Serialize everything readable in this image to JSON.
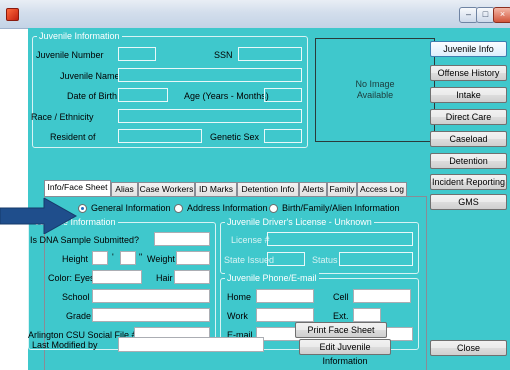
{
  "window": {
    "title": ""
  },
  "juvenile_info": {
    "legend": "Juvenile Information",
    "juvenile_number_label": "Juvenile Number",
    "ssn_label": "SSN",
    "juvenile_name_label": "Juvenile Name",
    "dob_label": "Date of Birth",
    "age_label": "Age (Years - Months)",
    "race_label": "Race / Ethnicity",
    "resident_label": "Resident of",
    "genetic_sex_label": "Genetic Sex"
  },
  "photo": {
    "text": "No Image Available"
  },
  "right_nav": [
    "Juvenile Info",
    "Offense History",
    "Intake",
    "Direct Care",
    "Caseload",
    "Detention",
    "Incident Reporting",
    "GMS"
  ],
  "close_label": "Close",
  "tabs": [
    "Info/Face Sheet",
    "Alias",
    "Case Workers",
    "ID Marks",
    "Detention Info",
    "Alerts",
    "Family",
    "Access Log"
  ],
  "view_options": [
    "General Information",
    "Address Information",
    "Birth/Family/Alien Information"
  ],
  "general": {
    "legend": "Juvenile Information",
    "dna_label": "Is DNA Sample Submitted?",
    "height_label": "Height",
    "feet_mark": "'",
    "inch_mark": "\"",
    "weight_label": "Weight",
    "eyes_label": "Color: Eyes",
    "hair_label": "Hair",
    "school_label": "School",
    "grade_label": "Grade",
    "csu_label": "Arlington CSU Social File #"
  },
  "license": {
    "legend": "Juvenile Driver's License - Unknown",
    "number_label": "License #",
    "state_label": "State Issued",
    "status_label": "Status"
  },
  "phone": {
    "legend": "Juvenile Phone/E-mail",
    "home_label": "Home",
    "cell_label": "Cell",
    "work_label": "Work",
    "ext_label": "Ext.",
    "email_label": "E-mail"
  },
  "print_face_sheet_label": "Print Face Sheet",
  "edit_info_label": "Edit Juvenile Information",
  "last_modified_label": "Last Modified by",
  "colors": {
    "client_bg": "#3fc8cc",
    "arrow": "#1f4e8c"
  }
}
